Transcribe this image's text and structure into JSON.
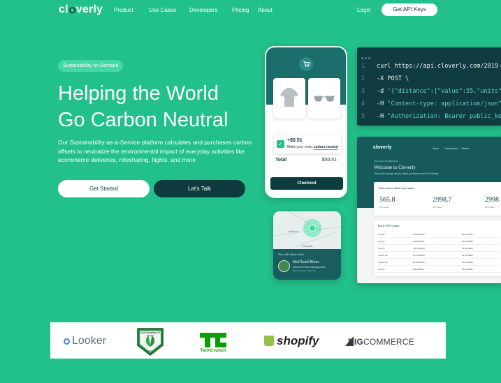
{
  "nav": {
    "logo": "cloverly",
    "links": [
      "Product",
      "Use Cases",
      "Developers",
      "Pricing",
      "About"
    ],
    "login": "Login",
    "cta": "Get API Keys"
  },
  "hero": {
    "badge": "Sustainability on Demand",
    "title_line1": "Helping the World",
    "title_line2": "Go Carbon Neutral",
    "description": "Our Sustainability-as-a-Service platform calculates and purchases carbon offsets to neutralize the environmental impact of everyday activities like ecommerce deliveries, ridesharing, flights, and more",
    "primary_button": "Get Started",
    "secondary_button": "Let's Talk"
  },
  "phone": {
    "offset_amount": "+$0.51",
    "offset_text": "Make your order",
    "offset_highlight": "carbon neutral",
    "total_label": "Total",
    "total_value": "$50.51",
    "checkout": "Checkout"
  },
  "code": {
    "lines": [
      {
        "n": "1",
        "text": "curl https://api.cloverly.com/2019-"
      },
      {
        "n": "2",
        "text": "-X POST \\"
      },
      {
        "n": "3",
        "prefix": "-d '",
        "text": "{\"distance\":{\"value\":55,\"units\""
      },
      {
        "n": "4",
        "prefix": "-H ",
        "text": "\"Content-type: application/json\""
      },
      {
        "n": "5",
        "prefix": "-H ",
        "text": "\"Authorization: Bearer public_ke"
      }
    ]
  },
  "dashboard": {
    "logo": "cloverly",
    "nav": [
      "Home",
      "Transactions",
      "Offsets"
    ],
    "small": "ACCOUNT DASHBOARD",
    "title": "Welcome to Cloverly",
    "subtitle": "View and manage carbon offset purchases and API settings",
    "card_title": "Total carbon offset purchases",
    "stats": [
      {
        "value": "565.8",
        "label": "Lbs Offset"
      },
      {
        "value": "2998.7",
        "label": "Lbs Offset"
      },
      {
        "value": "2998",
        "label": "Lbs Offset"
      }
    ],
    "table_title": "Daily API Usage",
    "rows": [
      {
        "date": "Aug 06",
        "a": "9013784863",
        "b": "46.8079800"
      },
      {
        "date": "Aug 06",
        "a": "4364264001",
        "b": "46.8079800"
      },
      {
        "date": "Aug 06",
        "a": "OTF-325280",
        "b": "46.8079800"
      },
      {
        "date": "August 06",
        "a": "9013784863",
        "b": "46.8079800"
      },
      {
        "date": "August 06",
        "a": "9013784863",
        "b": "46.8079800"
      },
      {
        "date": "Aug 06",
        "a": "BB-4989847",
        "b": "46.8079800"
      }
    ]
  },
  "map": {
    "label_left": "McCloud",
    "label_bottom": "Mountain",
    "offset_with": "You will offset with:",
    "project_name": "McCloud River",
    "project_desc": "Improved Forest Management",
    "project_loc": "Mount Shasta, California"
  },
  "logos": {
    "looker": "Looker",
    "award_top": "SUSTAINABILITY",
    "award_mid": "AWARD",
    "award_year": "2020",
    "techcrunch": "TechCrunch",
    "shopify": "shopify",
    "bigcommerce_big": "BIG",
    "bigcommerce_rest": "COMMERCE"
  },
  "colors": {
    "background": "#22c08a",
    "dark": "#0d3b3e",
    "accent": "#2be29d"
  }
}
